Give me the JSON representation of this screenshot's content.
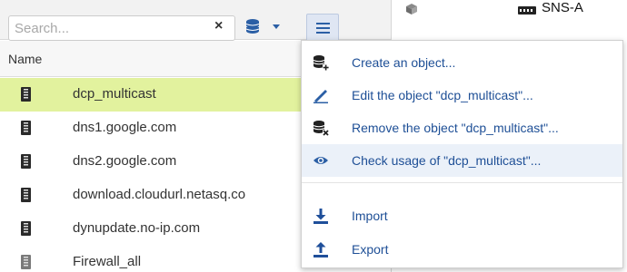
{
  "search": {
    "placeholder": "Search...",
    "value": ""
  },
  "toolbar": {
    "clear_glyph": "×"
  },
  "list": {
    "column_header": "Name",
    "items": [
      {
        "label": "dcp_multicast",
        "selected": true
      },
      {
        "label": "dns1.google.com",
        "selected": false
      },
      {
        "label": "dns2.google.com",
        "selected": false
      },
      {
        "label": "download.cloudurl.netasq.co",
        "selected": false
      },
      {
        "label": "dynupdate.no-ip.com",
        "selected": false
      },
      {
        "label": "Firewall_all",
        "selected": false
      }
    ]
  },
  "context_menu": {
    "items": [
      {
        "label": "Create an object...",
        "icon": "database-add-icon"
      },
      {
        "label": "Edit the object \"dcp_multicast\"...",
        "icon": "pencil-icon"
      },
      {
        "label": "Remove the object \"dcp_multicast\"...",
        "icon": "database-remove-icon"
      },
      {
        "label": "Check usage of \"dcp_multicast\"...",
        "icon": "eye-icon"
      },
      {
        "label": "Import",
        "icon": "import-icon"
      },
      {
        "label": "Export",
        "icon": "export-icon"
      }
    ]
  },
  "right_panel": {
    "node_label": "SNS-A"
  },
  "colors": {
    "accent": "#1e4f96",
    "selected_row": "#e2f29e",
    "menu_hover": "#ebf1f9",
    "icon_dark": "#222222"
  }
}
